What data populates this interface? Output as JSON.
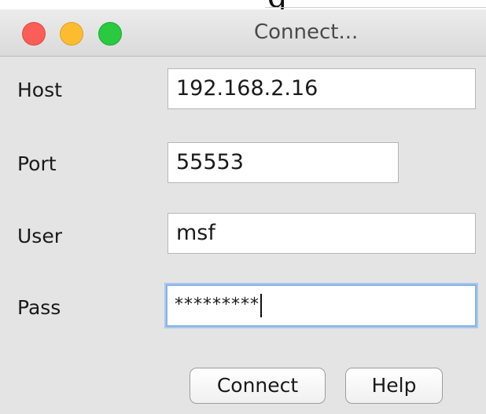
{
  "window": {
    "title": "Connect..."
  },
  "form": {
    "host_label": "Host",
    "host_value": "192.168.2.16",
    "port_label": "Port",
    "port_value": "55553",
    "user_label": "User",
    "user_value": "msf",
    "pass_label": "Pass",
    "pass_value": "*********"
  },
  "buttons": {
    "connect_label": "Connect",
    "help_label": "Help"
  },
  "colors": {
    "close": "#fc5d57",
    "minimize": "#fdbb2f",
    "zoom": "#29c940",
    "focus_ring": "#8ab3e4"
  },
  "icons": [
    "close-icon",
    "minimize-icon",
    "zoom-icon"
  ]
}
